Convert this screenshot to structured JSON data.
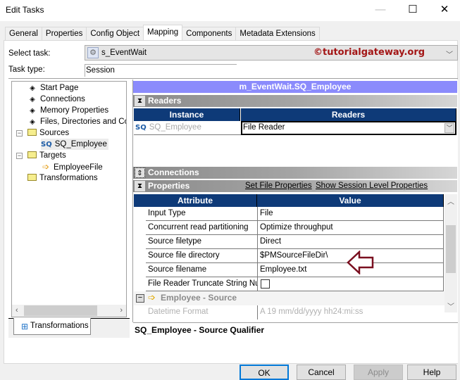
{
  "window": {
    "title": "Edit Tasks",
    "controls": [
      "minimize",
      "maximize",
      "close"
    ]
  },
  "tabs": [
    {
      "label": "General",
      "active": false
    },
    {
      "label": "Properties",
      "active": false
    },
    {
      "label": "Config Object",
      "active": false
    },
    {
      "label": "Mapping",
      "active": true
    },
    {
      "label": "Components",
      "active": false
    },
    {
      "label": "Metadata Extensions",
      "active": false
    }
  ],
  "select_task": {
    "label": "Select task:",
    "value": "s_EventWait",
    "watermark": "©tutorialgateway.org"
  },
  "task_type": {
    "label": "Task type:",
    "value": "Session"
  },
  "tree": {
    "items": [
      {
        "label": "Start Page",
        "icon": "diamond-icon"
      },
      {
        "label": "Connections",
        "icon": "diamond-icon"
      },
      {
        "label": "Memory Properties",
        "icon": "diamond-icon"
      },
      {
        "label": "Files, Directories and Commands",
        "icon": "diamond-icon"
      },
      {
        "label": "Sources",
        "icon": "folder-icon",
        "expanded": true
      },
      {
        "label": "SQ_Employee",
        "icon": "source-qualifier-icon",
        "selected": true
      },
      {
        "label": "Targets",
        "icon": "folder-icon",
        "expanded": true
      },
      {
        "label": "EmployeeFile",
        "icon": "target-file-icon"
      },
      {
        "label": "Transformations",
        "icon": "folder-icon"
      }
    ]
  },
  "bottom_tab": {
    "label": "Transformations"
  },
  "mapping": {
    "header": "m_EventWait.SQ_Employee",
    "readers_section": "Readers",
    "readers_table": {
      "columns": [
        "Instance",
        "Readers"
      ],
      "rows": [
        {
          "instance": "SQ_Employee",
          "reader": "File Reader"
        }
      ]
    },
    "connections_section": "Connections",
    "properties_section": "Properties",
    "links": {
      "set_file_properties": "Set File Properties",
      "show_session_level": "Show Session Level Properties"
    },
    "properties_table": {
      "columns": [
        "Attribute",
        "Value"
      ],
      "rows": [
        {
          "attribute": "Input Type",
          "value": "File"
        },
        {
          "attribute": "Concurrent read partitioning",
          "value": "Optimize throughput"
        },
        {
          "attribute": "Source filetype",
          "value": "Direct"
        },
        {
          "attribute": "Source file directory",
          "value": "$PMSourceFileDir\\"
        },
        {
          "attribute": "Source filename",
          "value": "Employee.txt"
        },
        {
          "attribute": "File Reader Truncate String Null",
          "value": "",
          "checkbox": false
        }
      ],
      "group": {
        "label": "Employee - Source"
      },
      "group_rows": [
        {
          "attribute": "Datetime Format",
          "value": "A  19 mm/dd/yyyy hh24:mi:ss"
        }
      ]
    },
    "description": "SQ_Employee - Source Qualifier"
  },
  "buttons": {
    "ok": "OK",
    "cancel": "Cancel",
    "apply": "Apply",
    "help": "Help"
  },
  "colors": {
    "grid_header": "#0e3a78",
    "mapping_header": "#8b8bfc",
    "watermark": "#a31515",
    "annotation_arrow": "#7a1020"
  }
}
